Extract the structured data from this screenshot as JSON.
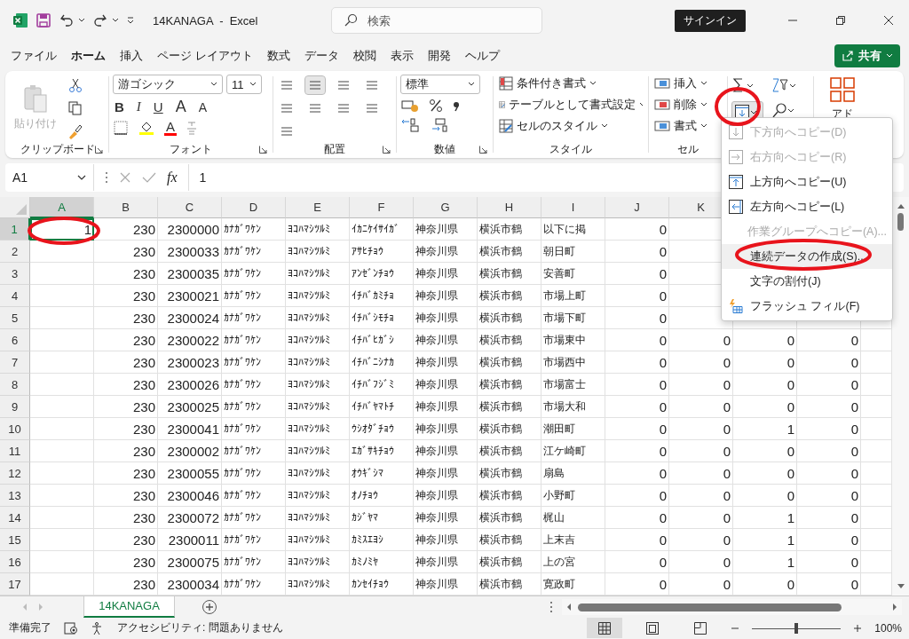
{
  "window": {
    "title": "14KANAGA  -  Excel"
  },
  "search": {
    "placeholder": "検索"
  },
  "sign_in": "サインイン",
  "tabs": [
    {
      "label": "ファイル",
      "selected": false
    },
    {
      "label": "ホーム",
      "selected": true
    },
    {
      "label": "挿入",
      "selected": false
    },
    {
      "label": "ページ レイアウト",
      "selected": false
    },
    {
      "label": "数式",
      "selected": false
    },
    {
      "label": "データ",
      "selected": false
    },
    {
      "label": "校閲",
      "selected": false
    },
    {
      "label": "表示",
      "selected": false
    },
    {
      "label": "開発",
      "selected": false
    },
    {
      "label": "ヘルプ",
      "selected": false
    }
  ],
  "share": {
    "label": "共有"
  },
  "ribbon": {
    "clipboard": {
      "paste_label": "貼り付け",
      "paste_disabled": true,
      "group_label": "クリップボード"
    },
    "font": {
      "font_name": "游ゴシック",
      "font_size": "11",
      "bold": "B",
      "italic": "I",
      "underline": "U",
      "grow": "A",
      "shrink": "A",
      "font_color": "A",
      "group_label": "フォント"
    },
    "alignment": {
      "group_label": "配置"
    },
    "number": {
      "format": "標準",
      "group_label": "数値"
    },
    "styles": {
      "items": [
        "条件付き書式",
        "テーブルとして書式設定",
        "セルのスタイル"
      ],
      "group_label": "スタイル"
    },
    "cells": {
      "items": [
        "挿入",
        "削除",
        "書式"
      ],
      "group_label": "セル"
    },
    "addins": {
      "label": "アド"
    }
  },
  "formula_bar": {
    "name_box": "A1",
    "function_label": "fx",
    "value": "1"
  },
  "columns": [
    {
      "label": "A",
      "kind": "number",
      "selected": true
    },
    {
      "label": "B",
      "kind": "number",
      "selected": false
    },
    {
      "label": "C",
      "kind": "number",
      "selected": false
    },
    {
      "label": "D",
      "kind": "text",
      "selected": false
    },
    {
      "label": "E",
      "kind": "text",
      "selected": false
    },
    {
      "label": "F",
      "kind": "text",
      "selected": false
    },
    {
      "label": "G",
      "kind": "text",
      "selected": false
    },
    {
      "label": "H",
      "kind": "text",
      "selected": false
    },
    {
      "label": "I",
      "kind": "text",
      "selected": false
    },
    {
      "label": "J",
      "kind": "number",
      "selected": false
    },
    {
      "label": "K",
      "kind": "number",
      "selected": false
    },
    {
      "kind": "number"
    },
    {
      "kind": "number"
    }
  ],
  "rows": [
    {
      "header": "1",
      "selected": true,
      "cells": [
        "1",
        "230",
        "2300000",
        "ｶﾅｶﾞﾜｹﾝ",
        "ﾖｺﾊﾏｼﾂﾙﾐ",
        "ｲｶﾆｹｲｻｲｶﾞ",
        "神奈川県",
        "横浜市鶴",
        "以下に掲",
        "0",
        null,
        null,
        null
      ]
    },
    {
      "header": "2",
      "selected": false,
      "cells": [
        null,
        "230",
        "2300033",
        "ｶﾅｶﾞﾜｹﾝ",
        "ﾖｺﾊﾏｼﾂﾙﾐ",
        "ｱｻﾋﾁｮｳ",
        "神奈川県",
        "横浜市鶴",
        "朝日町",
        "0",
        null,
        null,
        null
      ]
    },
    {
      "header": "3",
      "selected": false,
      "cells": [
        null,
        "230",
        "2300035",
        "ｶﾅｶﾞﾜｹﾝ",
        "ﾖｺﾊﾏｼﾂﾙﾐ",
        "ｱﾝｾﾞﾝﾁｮｳ",
        "神奈川県",
        "横浜市鶴",
        "安善町",
        "0",
        null,
        null,
        null
      ]
    },
    {
      "header": "4",
      "selected": false,
      "cells": [
        null,
        "230",
        "2300021",
        "ｶﾅｶﾞﾜｹﾝ",
        "ﾖｺﾊﾏｼﾂﾙﾐ",
        "ｲﾁﾊﾞｶﾐﾁｮ",
        "神奈川県",
        "横浜市鶴",
        "市場上町",
        "0",
        null,
        null,
        null
      ]
    },
    {
      "header": "5",
      "selected": false,
      "cells": [
        null,
        "230",
        "2300024",
        "ｶﾅｶﾞﾜｹﾝ",
        "ﾖｺﾊﾏｼﾂﾙﾐ",
        "ｲﾁﾊﾞｼﾓﾁｮ",
        "神奈川県",
        "横浜市鶴",
        "市場下町",
        "0",
        null,
        null,
        null
      ]
    },
    {
      "header": "6",
      "selected": false,
      "cells": [
        null,
        "230",
        "2300022",
        "ｶﾅｶﾞﾜｹﾝ",
        "ﾖｺﾊﾏｼﾂﾙﾐ",
        "ｲﾁﾊﾞﾋｶﾞｼ",
        "神奈川県",
        "横浜市鶴",
        "市場東中",
        "0",
        "0",
        "0",
        "0"
      ]
    },
    {
      "header": "7",
      "selected": false,
      "cells": [
        null,
        "230",
        "2300023",
        "ｶﾅｶﾞﾜｹﾝ",
        "ﾖｺﾊﾏｼﾂﾙﾐ",
        "ｲﾁﾊﾞﾆｼﾅｶ",
        "神奈川県",
        "横浜市鶴",
        "市場西中",
        "0",
        "0",
        "0",
        "0"
      ]
    },
    {
      "header": "8",
      "selected": false,
      "cells": [
        null,
        "230",
        "2300026",
        "ｶﾅｶﾞﾜｹﾝ",
        "ﾖｺﾊﾏｼﾂﾙﾐ",
        "ｲﾁﾊﾞﾌｼﾞﾐ",
        "神奈川県",
        "横浜市鶴",
        "市場富士",
        "0",
        "0",
        "0",
        "0"
      ]
    },
    {
      "header": "9",
      "selected": false,
      "cells": [
        null,
        "230",
        "2300025",
        "ｶﾅｶﾞﾜｹﾝ",
        "ﾖｺﾊﾏｼﾂﾙﾐ",
        "ｲﾁﾊﾞﾔﾏﾄﾁ",
        "神奈川県",
        "横浜市鶴",
        "市場大和",
        "0",
        "0",
        "0",
        "0"
      ]
    },
    {
      "header": "10",
      "selected": false,
      "cells": [
        null,
        "230",
        "2300041",
        "ｶﾅｶﾞﾜｹﾝ",
        "ﾖｺﾊﾏｼﾂﾙﾐ",
        "ｳｼｵﾀﾞﾁｮｳ",
        "神奈川県",
        "横浜市鶴",
        "潮田町",
        "0",
        "0",
        "1",
        "0"
      ]
    },
    {
      "header": "11",
      "selected": false,
      "cells": [
        null,
        "230",
        "2300002",
        "ｶﾅｶﾞﾜｹﾝ",
        "ﾖｺﾊﾏｼﾂﾙﾐ",
        "ｴｶﾞｻｷﾁｮｳ",
        "神奈川県",
        "横浜市鶴",
        "江ケ崎町",
        "0",
        "0",
        "0",
        "0"
      ]
    },
    {
      "header": "12",
      "selected": false,
      "cells": [
        null,
        "230",
        "2300055",
        "ｶﾅｶﾞﾜｹﾝ",
        "ﾖｺﾊﾏｼﾂﾙﾐ",
        "ｵｳｷﾞｼﾏ",
        "神奈川県",
        "横浜市鶴",
        "扇島",
        "0",
        "0",
        "0",
        "0"
      ]
    },
    {
      "header": "13",
      "selected": false,
      "cells": [
        null,
        "230",
        "2300046",
        "ｶﾅｶﾞﾜｹﾝ",
        "ﾖｺﾊﾏｼﾂﾙﾐ",
        "ｵﾉﾁｮｳ",
        "神奈川県",
        "横浜市鶴",
        "小野町",
        "0",
        "0",
        "0",
        "0"
      ]
    },
    {
      "header": "14",
      "selected": false,
      "cells": [
        null,
        "230",
        "2300072",
        "ｶﾅｶﾞﾜｹﾝ",
        "ﾖｺﾊﾏｼﾂﾙﾐ",
        "ｶｼﾞﾔﾏ",
        "神奈川県",
        "横浜市鶴",
        "梶山",
        "0",
        "0",
        "1",
        "0"
      ]
    },
    {
      "header": "15",
      "selected": false,
      "cells": [
        null,
        "230",
        "2300011",
        "ｶﾅｶﾞﾜｹﾝ",
        "ﾖｺﾊﾏｼﾂﾙﾐ",
        "ｶﾐｽｴﾖｼ",
        "神奈川県",
        "横浜市鶴",
        "上末吉",
        "0",
        "0",
        "1",
        "0"
      ]
    },
    {
      "header": "16",
      "selected": false,
      "cells": [
        null,
        "230",
        "2300075",
        "ｶﾅｶﾞﾜｹﾝ",
        "ﾖｺﾊﾏｼﾂﾙﾐ",
        "ｶﾐﾉﾐﾔ",
        "神奈川県",
        "横浜市鶴",
        "上の宮",
        "0",
        "0",
        "1",
        "0"
      ]
    },
    {
      "header": "17",
      "selected": false,
      "cells": [
        null,
        "230",
        "2300034",
        "ｶﾅｶﾞﾜｹﾝ",
        "ﾖｺﾊﾏｼﾂﾙﾐ",
        "ｶﾝｾｲﾁｮｳ",
        "神奈川県",
        "横浜市鶴",
        "寛政町",
        "0",
        "0",
        "0",
        "0"
      ]
    }
  ],
  "fill_menu": [
    {
      "label": "下方向へコピー(D)",
      "kind": "down",
      "disabled": true,
      "selected": false
    },
    {
      "label": "右方向へコピー(R)",
      "kind": "right",
      "disabled": true,
      "selected": false
    },
    {
      "label": "上方向へコピー(U)",
      "kind": "up",
      "disabled": false,
      "selected": false
    },
    {
      "label": "左方向へコピー(L)",
      "kind": "left",
      "disabled": false,
      "selected": false
    },
    {
      "label": "作業グループへコピー(A)...",
      "kind": "plain",
      "disabled": true,
      "selected": false
    },
    {
      "label": "連続データの作成(S)...",
      "kind": "plain",
      "disabled": false,
      "selected": true
    },
    {
      "label": "文字の割付(J)",
      "kind": "plain",
      "disabled": false,
      "selected": false
    },
    {
      "label": "フラッシュ フィル(F)",
      "kind": "flash",
      "disabled": false,
      "selected": false
    }
  ],
  "sheet_tabs": [
    {
      "label": "14KANAGA",
      "selected": true
    }
  ],
  "status_bar": {
    "ready": "準備完了",
    "accessibility": "アクセシビリティ: 問題ありません",
    "views": [
      {
        "kind": "normal",
        "selected": true
      },
      {
        "kind": "page_layout",
        "selected": false
      },
      {
        "kind": "page_break",
        "selected": false
      }
    ],
    "zoom": {
      "level": 0.5,
      "reading": "100%"
    }
  }
}
